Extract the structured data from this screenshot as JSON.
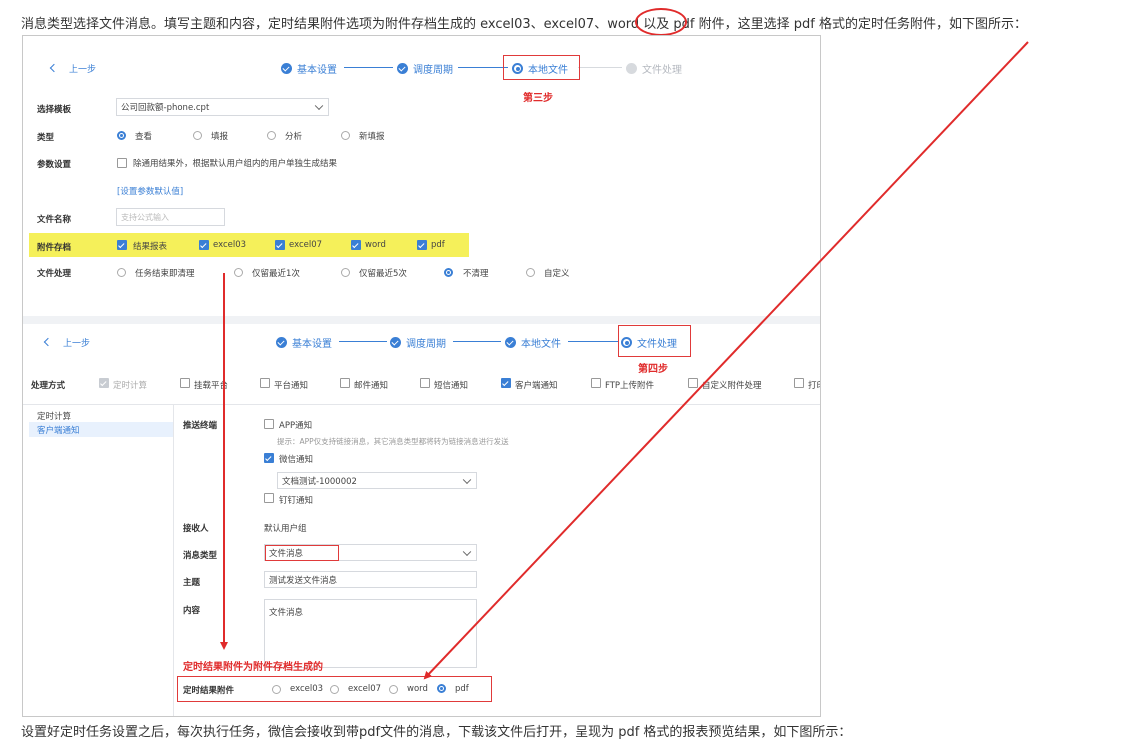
{
  "intro_text": "消息类型选择文件消息。填写主题和内容，定时结果附件选项为附件存档生成的 excel03、excel07、word 以及 pdf 附件，这里选择 pdf 格式的定时任务附件，如下图所示：",
  "outro_text": "设置好定时任务设置之后，每次执行任务，微信会接收到带pdf文件的消息，下载该文件后打开，呈现为 pdf 格式的报表预览结果，如下图所示：",
  "colors": {
    "accent": "#3a7fd5",
    "highlight": "#f5f05a",
    "annotation_red": "#e02b2b"
  },
  "panel1": {
    "back": "上一步",
    "steps": [
      {
        "label": "基本设置",
        "state": "done"
      },
      {
        "label": "调度周期",
        "state": "done"
      },
      {
        "label": "本地文件",
        "state": "current"
      },
      {
        "label": "文件处理",
        "state": "pending"
      }
    ],
    "step_annotation": "第三步",
    "template_label": "选择模板",
    "template_value": "公司回款额-phone.cpt",
    "type_label": "类型",
    "types": [
      "查看",
      "填报",
      "分析",
      "新填报"
    ],
    "type_selected": "查看",
    "params_label": "参数设置",
    "params_checkbox": "除通用结果外，根据默认用户组内的用户单独生成结果",
    "params_link": "[设置参数默认值]",
    "filename_label": "文件名称",
    "filename_placeholder": "支持公式输入",
    "archive_label": "附件存档",
    "archive_items": [
      "结果报表",
      "excel03",
      "excel07",
      "word",
      "pdf"
    ],
    "fileproc_label": "文件处理",
    "fileproc_options": [
      "任务结束即清理",
      "仅留最近1次",
      "仅留最近5次",
      "不清理",
      "自定义"
    ],
    "fileproc_selected": "不清理"
  },
  "panel2": {
    "back": "上一步",
    "steps": [
      {
        "label": "基本设置",
        "state": "done"
      },
      {
        "label": "调度周期",
        "state": "done"
      },
      {
        "label": "本地文件",
        "state": "done"
      },
      {
        "label": "文件处理",
        "state": "current"
      }
    ],
    "step_annotation": "第四步",
    "method_label": "处理方式",
    "methods": [
      {
        "label": "定时计算",
        "state": "disabled"
      },
      {
        "label": "挂载平台",
        "state": "off"
      },
      {
        "label": "平台通知",
        "state": "off"
      },
      {
        "label": "邮件通知",
        "state": "off"
      },
      {
        "label": "短信通知",
        "state": "off"
      },
      {
        "label": "客户端通知",
        "state": "on"
      },
      {
        "label": "FTP上传附件",
        "state": "off"
      },
      {
        "label": "自定义附件处理",
        "state": "off"
      },
      {
        "label": "打印",
        "state": "off"
      }
    ],
    "sidebar": [
      "定时计算",
      "客户端通知"
    ],
    "push_label": "推送终端",
    "app_notify": "APP通知",
    "app_hint": "提示：APP仅支持链接消息，其它消息类型都将转为链接消息进行发送",
    "wechat_notify": "微信通知",
    "wechat_account": "文档测试-1000002",
    "dingding_notify": "钉钉通知",
    "receiver_label": "接收人",
    "receiver_value": "默认用户组",
    "msgtype_label": "消息类型",
    "msgtype_value": "文件消息",
    "subject_label": "主题",
    "subject_value": "测试发送文件消息",
    "content_label": "内容",
    "content_value": "文件消息",
    "attach_annotation": "定时结果附件为附件存档生成的",
    "attach_label": "定时结果附件",
    "attach_options": [
      "excel03",
      "excel07",
      "word",
      "pdf"
    ],
    "attach_selected": "pdf"
  }
}
